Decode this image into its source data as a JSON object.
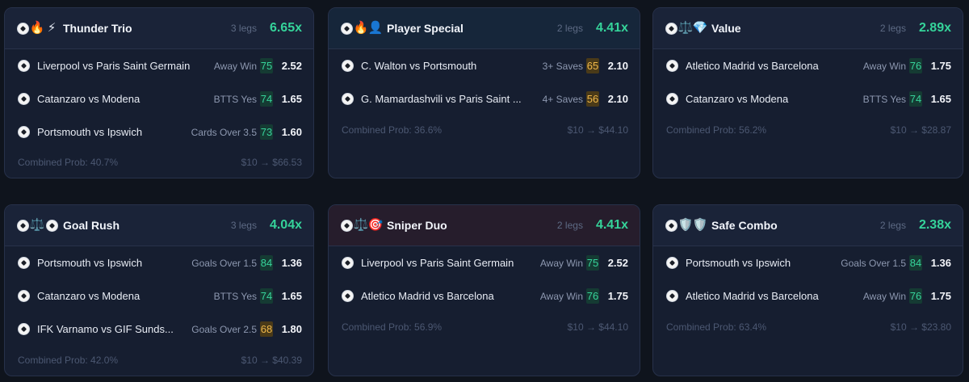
{
  "cards": [
    {
      "title": "Thunder Trio",
      "icons": [
        "soccer-ball-icon",
        "fire-icon",
        "lightning-icon"
      ],
      "legs_label": "3 legs",
      "multiplier": "6.65x",
      "legs": [
        {
          "match": "Liverpool vs Paris Saint Germain",
          "market": "Away Win",
          "confidence": "75",
          "odds": "2.52"
        },
        {
          "match": "Catanzaro vs Modena",
          "market": "BTTS Yes",
          "confidence": "74",
          "odds": "1.65"
        },
        {
          "match": "Portsmouth vs Ipswich",
          "market": "Cards Over 3.5",
          "confidence": "73",
          "odds": "1.60"
        }
      ],
      "combined_prob": "Combined Prob: 40.7%",
      "payout": "$10 → $66.53"
    },
    {
      "title": "Player Special",
      "icons": [
        "soccer-ball-icon",
        "fire-icon",
        "person-icon"
      ],
      "legs_label": "2 legs",
      "multiplier": "4.41x",
      "legs": [
        {
          "match": "C. Walton vs Portsmouth",
          "market": "3+ Saves",
          "confidence": "65",
          "odds": "2.10"
        },
        {
          "match": "G. Mamardashvili vs Paris Saint ...",
          "market": "4+ Saves",
          "confidence": "56",
          "odds": "2.10"
        }
      ],
      "combined_prob": "Combined Prob: 36.6%",
      "payout": "$10 → $44.10"
    },
    {
      "title": "Value",
      "icons": [
        "soccer-ball-icon",
        "scales-icon",
        "diamond-icon"
      ],
      "legs_label": "2 legs",
      "multiplier": "2.89x",
      "legs": [
        {
          "match": "Atletico Madrid vs Barcelona",
          "market": "Away Win",
          "confidence": "76",
          "odds": "1.75"
        },
        {
          "match": "Catanzaro vs Modena",
          "market": "BTTS Yes",
          "confidence": "74",
          "odds": "1.65"
        }
      ],
      "combined_prob": "Combined Prob: 56.2%",
      "payout": "$10 → $28.87"
    },
    {
      "title": "Goal Rush",
      "icons": [
        "soccer-ball-icon",
        "scales-icon",
        "soccer-ball-icon"
      ],
      "legs_label": "3 legs",
      "multiplier": "4.04x",
      "legs": [
        {
          "match": "Portsmouth vs Ipswich",
          "market": "Goals Over 1.5",
          "confidence": "84",
          "odds": "1.36"
        },
        {
          "match": "Catanzaro vs Modena",
          "market": "BTTS Yes",
          "confidence": "74",
          "odds": "1.65"
        },
        {
          "match": "IFK Varnamo vs GIF Sunds...",
          "market": "Goals Over 2.5",
          "confidence": "68",
          "odds": "1.80"
        }
      ],
      "combined_prob": "Combined Prob: 42.0%",
      "payout": "$10 → $40.39"
    },
    {
      "title": "Sniper Duo",
      "icons": [
        "soccer-ball-icon",
        "scales-icon",
        "target-icon"
      ],
      "legs_label": "2 legs",
      "multiplier": "4.41x",
      "legs": [
        {
          "match": "Liverpool vs Paris Saint Germain",
          "market": "Away Win",
          "confidence": "75",
          "odds": "2.52"
        },
        {
          "match": "Atletico Madrid vs Barcelona",
          "market": "Away Win",
          "confidence": "76",
          "odds": "1.75"
        }
      ],
      "combined_prob": "Combined Prob: 56.9%",
      "payout": "$10 → $44.10"
    },
    {
      "title": "Safe Combo",
      "icons": [
        "soccer-ball-icon",
        "shield-icon",
        "shield-icon"
      ],
      "legs_label": "2 legs",
      "multiplier": "2.38x",
      "legs": [
        {
          "match": "Portsmouth vs Ipswich",
          "market": "Goals Over 1.5",
          "confidence": "84",
          "odds": "1.36"
        },
        {
          "match": "Atletico Madrid vs Barcelona",
          "market": "Away Win",
          "confidence": "76",
          "odds": "1.75"
        }
      ],
      "combined_prob": "Combined Prob: 63.4%",
      "payout": "$10 → $23.80"
    }
  ],
  "colors": {
    "accent_green": "#35d39a",
    "confidence_high": "#37d49b",
    "confidence_mid": "#f0b84a",
    "background": "#0f141d",
    "card": "#161e30"
  }
}
